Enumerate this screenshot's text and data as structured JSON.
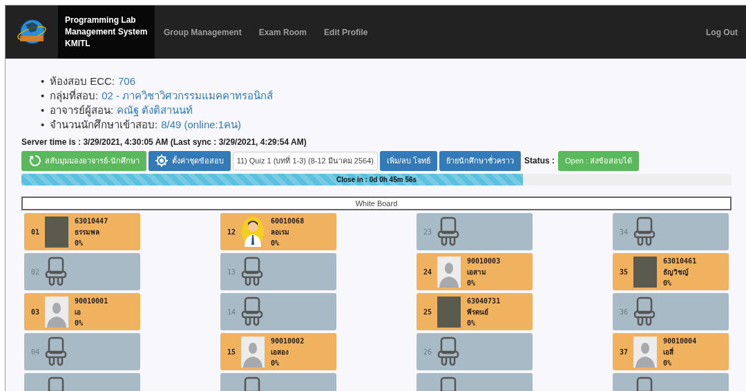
{
  "navbar": {
    "brand_lines": [
      "Programming Lab",
      "Management System",
      "KMITL"
    ],
    "links": [
      "Group Management",
      "Exam Room",
      "Edit Profile"
    ],
    "logout": "Log Out"
  },
  "info": [
    {
      "marker": "•",
      "label": "ห้องสอบ ECC:",
      "value": "706"
    },
    {
      "marker": "•",
      "label": "กลุ่มที่สอบ:",
      "value": "02 - ภาควิชาวิศวกรรมแมคคาทรอนิกส์"
    },
    {
      "marker": "•",
      "label": "อาจารย์ผู้สอน:",
      "value": "คณัฐ ตังติสานนท์"
    },
    {
      "marker": "•",
      "label": "จำนวนนักศึกษาเข้าสอบ:",
      "value": "8/49 (online:1คน)"
    }
  ],
  "server_time": "Server time is : 3/29/2021, 4:30:05 AM (Last sync : 3/29/2021, 4:29:54 AM)",
  "toolbar": [
    {
      "kind": "button",
      "color": "#5cb85c",
      "label": "สลับมุมมองอาจารย์-นักศึกษา"
    },
    {
      "kind": "button",
      "color": "#337ab7",
      "label": "ตั้งค่าชุดข้อสอบ"
    },
    {
      "kind": "select",
      "label": "11) Quiz 1 (บทที่ 1-3) (8-12 มีนาคม 2564)"
    },
    {
      "kind": "button",
      "color": "#337ab7",
      "label": "เพิ่ม/ลบ โจทย์"
    },
    {
      "kind": "button",
      "color": "#337ab7",
      "label": "ย้ายนักศึกษาชั่วคราว"
    },
    {
      "kind": "text",
      "label": "Status :"
    },
    {
      "kind": "badge",
      "color": "#5cb85c",
      "label": "Open : ส่งข้อสอบได้"
    }
  ],
  "timer": {
    "label": "Close in : 0d 0h 45m 56s",
    "level": 0.706
  },
  "whiteboard": "White Board",
  "seat_columns": [
    [
      {
        "kind": "occupied",
        "number": "01",
        "student_id": "63010447",
        "name": "ธรรมพล",
        "progress": "0%",
        "avatar": {
          "kind": "photo"
        }
      },
      {
        "kind": "empty",
        "number": "02"
      },
      {
        "kind": "occupied",
        "number": "03",
        "student_id": "90010001",
        "name": "เอ",
        "progress": "0%",
        "avatar": {
          "kind": "silhouette"
        }
      },
      {
        "kind": "empty",
        "number": "04"
      },
      {
        "kind": "empty"
      }
    ],
    [
      {
        "kind": "occupied",
        "number": "12",
        "student_id": "60010068",
        "name": "ลอเรม",
        "progress": "0%",
        "avatar": {
          "kind": "cartoon"
        }
      },
      {
        "kind": "empty",
        "number": "13"
      },
      {
        "kind": "empty",
        "number": "14"
      },
      {
        "kind": "occupied",
        "number": "15",
        "student_id": "90010002",
        "name": "เอสอง",
        "progress": "0%",
        "avatar": {
          "kind": "silhouette"
        }
      },
      {
        "kind": "empty"
      }
    ],
    [
      {
        "kind": "empty",
        "number": "23"
      },
      {
        "kind": "occupied",
        "number": "24",
        "student_id": "90010003",
        "name": "เอสาม",
        "progress": "0%",
        "avatar": {
          "kind": "silhouette"
        }
      },
      {
        "kind": "occupied",
        "number": "25",
        "student_id": "63040731",
        "name": "พีรดนย์",
        "progress": "0%",
        "avatar": {
          "kind": "photo"
        }
      },
      {
        "kind": "empty",
        "number": "26"
      },
      {
        "kind": "empty"
      }
    ],
    [
      {
        "kind": "empty",
        "number": "34"
      },
      {
        "kind": "occupied",
        "number": "35",
        "student_id": "63010461",
        "name": "ธัญวิชญ์",
        "progress": "0%",
        "avatar": {
          "kind": "photo"
        }
      },
      {
        "kind": "empty",
        "number": "36"
      },
      {
        "kind": "occupied",
        "number": "37",
        "student_id": "90010004",
        "name": "เอสี่",
        "progress": "0%",
        "avatar": {
          "kind": "silhouette"
        }
      },
      {
        "kind": "empty"
      }
    ]
  ]
}
